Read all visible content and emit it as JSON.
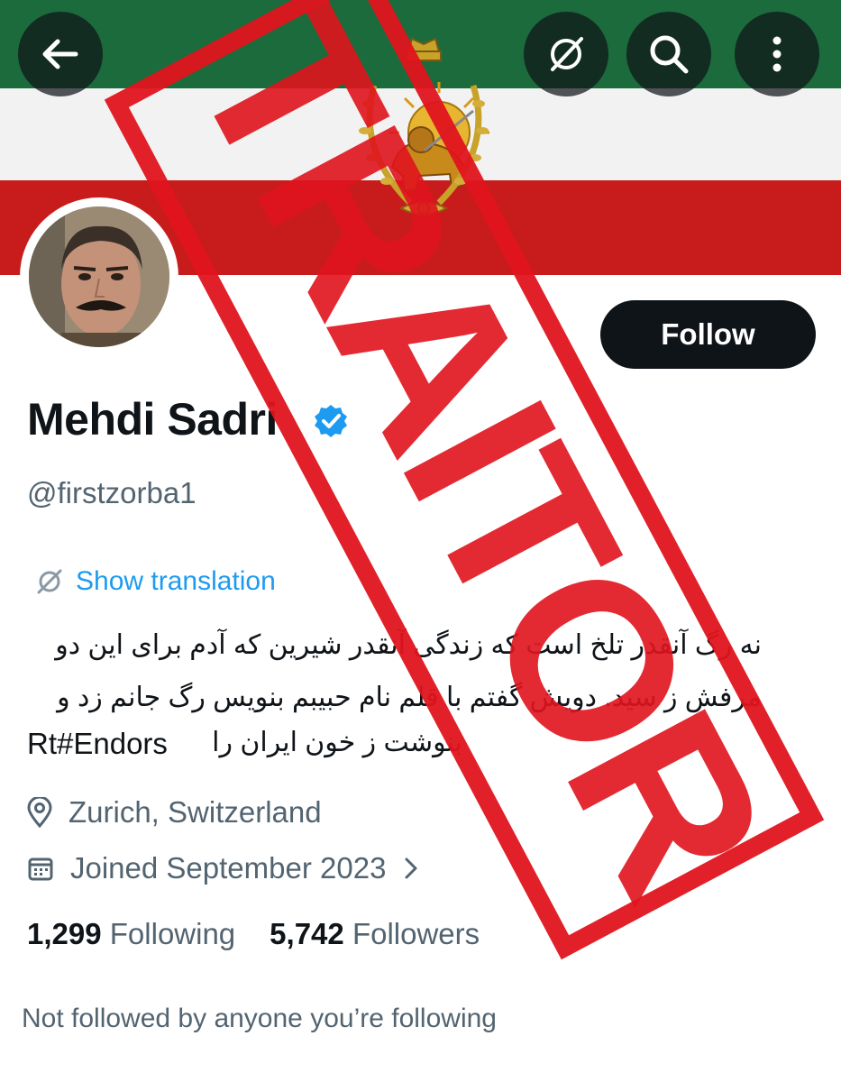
{
  "profile": {
    "name": "Mehdi Sadri",
    "handle": "@firstzorba1",
    "follow_label": "Follow",
    "show_translation": "Show translation",
    "bio_lines": [
      "نه رگ آنقدر تلخ است که زندگی آنقدر شیرین که آدم برای این دو",
      "مرفش ز سید. دویش گفتم با قلم نام حبیبم بنویس رگ جانم زد و",
      "بنوشت ز خون ایران را"
    ],
    "bio_tag": "Rt#Endors",
    "location": "Zurich, Switzerland",
    "joined": "Joined September 2023",
    "following_count": "1,299",
    "following_label": "Following",
    "followers_count": "5,742",
    "followers_label": "Followers",
    "not_followed": "Not followed by anyone you’re following"
  },
  "overlay": {
    "stamp_text": "TRAITOR"
  },
  "colors": {
    "banner_green": "#1c6b3c",
    "banner_white": "#f2f2f2",
    "banner_red": "#c81c1c",
    "link_blue": "#1d9bf0",
    "verified_blue": "#1d9bf0",
    "stamp_red": "#e0141e",
    "secondary_text": "#536471"
  },
  "icons": [
    "back-arrow-icon",
    "grok-icon",
    "search-icon",
    "more-vertical-icon",
    "verified-badge-icon",
    "translate-icon",
    "location-icon",
    "calendar-icon",
    "chevron-right-icon"
  ]
}
